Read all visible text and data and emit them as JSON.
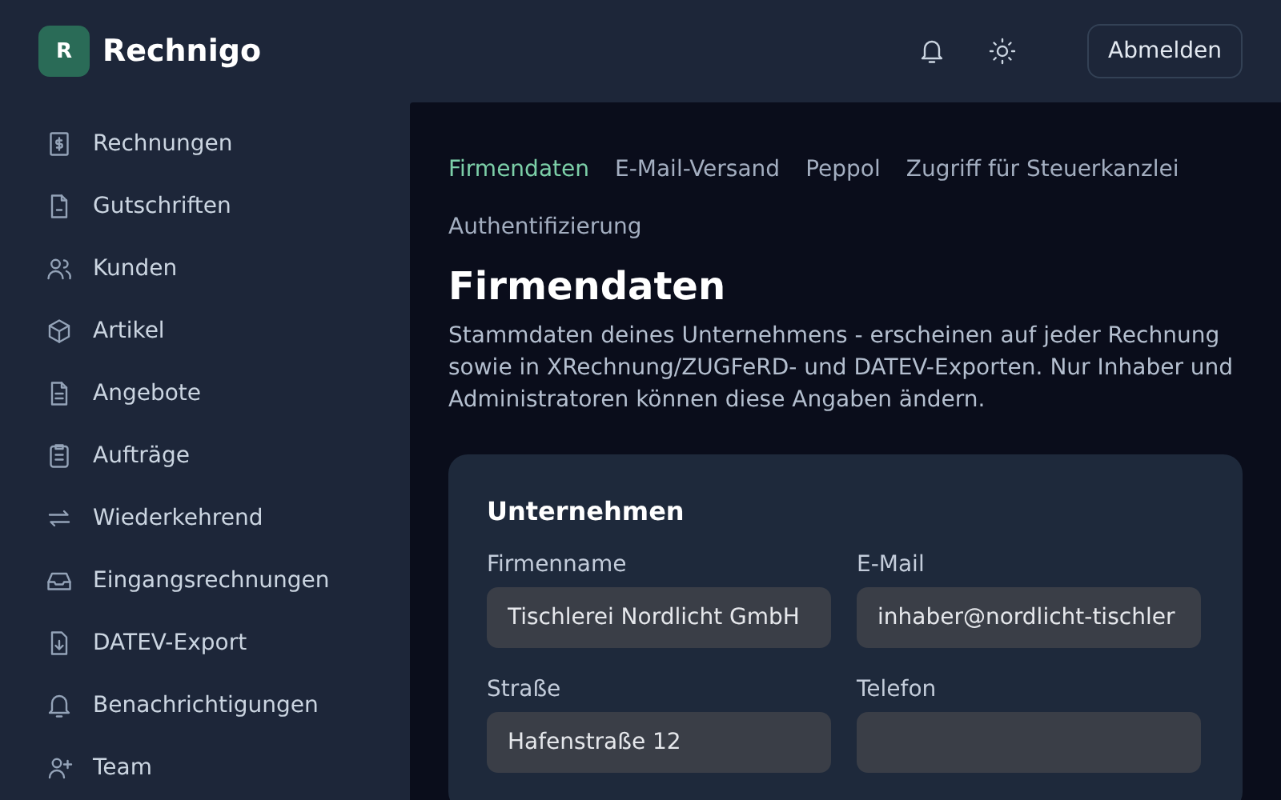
{
  "header": {
    "logo_letter": "R",
    "app_name": "Rechnigo",
    "logout_button": "Abmelden"
  },
  "sidebar": {
    "items": [
      {
        "label": "Rechnungen",
        "selected": false
      },
      {
        "label": "Gutschriften",
        "selected": false
      },
      {
        "label": "Kunden",
        "selected": false
      },
      {
        "label": "Artikel",
        "selected": false
      },
      {
        "label": "Angebote",
        "selected": false
      },
      {
        "label": "Aufträge",
        "selected": false
      },
      {
        "label": "Wiederkehrend",
        "selected": false
      },
      {
        "label": "Eingangsrechnungen",
        "selected": false
      },
      {
        "label": "DATEV-Export",
        "selected": false
      },
      {
        "label": "Benachrichtigungen",
        "selected": false
      },
      {
        "label": "Team",
        "selected": false
      }
    ]
  },
  "tabs": [
    {
      "label": "Firmendaten",
      "selected": true
    },
    {
      "label": "E-Mail-Versand",
      "selected": false
    },
    {
      "label": "Peppol",
      "selected": false
    },
    {
      "label": "Zugriff für Steuerkanzlei",
      "selected": false
    },
    {
      "label": "Authentifizierung",
      "selected": false
    }
  ],
  "page": {
    "title": "Firmendaten",
    "description": "Stammdaten deines Unternehmens - erscheinen auf jeder Rechnung sowie in XRechnung/ZUGFeRD- und DATEV-Exporten. Nur Inhaber und Administratoren können diese Angaben ändern."
  },
  "card": {
    "title": "Unternehmen",
    "fields": [
      {
        "label": "Firmenname",
        "value": "Tischlerei Nordlicht GmbH"
      },
      {
        "label": "E-Mail",
        "value": "inhaber@nordlicht-tischler"
      },
      {
        "label": "Straße",
        "value": "Hafenstraße 12"
      },
      {
        "label": "Telefon"
      }
    ]
  }
}
